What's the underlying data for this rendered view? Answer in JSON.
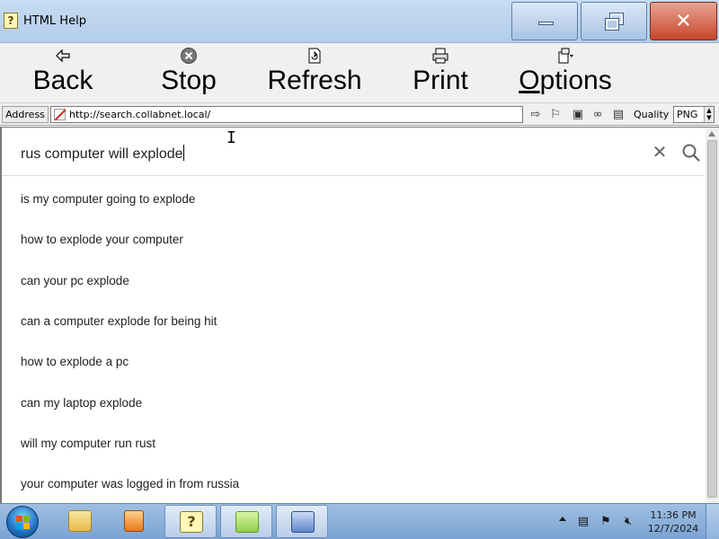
{
  "window": {
    "title": "HTML Help"
  },
  "toolbar": {
    "back_label": "Back",
    "stop_label": "Stop",
    "refresh_label": "Refresh",
    "print_label": "Print",
    "options_label_first": "O",
    "options_label_rest": "ptions"
  },
  "address_bar": {
    "label": "Address",
    "url": "http://search.collabnet.local/",
    "quality_label": "Quality",
    "quality_value": "PNG"
  },
  "search": {
    "query": "rus  computer will explode",
    "suggestions": [
      "is my computer going to explode",
      "how to explode your computer",
      "can your pc explode",
      "can a computer explode for being hit",
      "how to explode a pc",
      "can my laptop explode",
      "will my computer run rust",
      "your computer was logged in from russia"
    ]
  },
  "taskbar": {
    "clock_time": "11:36 PM",
    "clock_date": "12/7/2024"
  },
  "colors": {
    "titlebar": "#b3cdeb",
    "close_button": "#c8452a",
    "taskbar": "#7aa3d3",
    "suggestion_text": "#202124"
  }
}
